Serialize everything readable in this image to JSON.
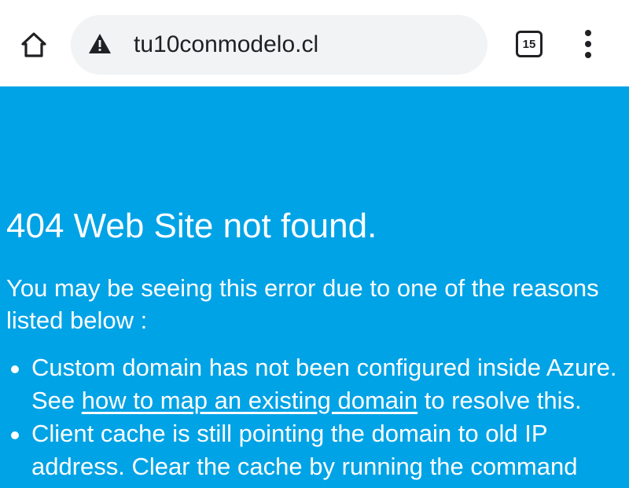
{
  "browser": {
    "url": "tu10conmodelo.cl",
    "tab_count": "15",
    "icons": {
      "home": "home-icon",
      "security": "warning-triangle-icon",
      "tabs": "tab-switcher-icon",
      "menu": "more-vert-icon"
    }
  },
  "page": {
    "background_color": "#00a3e6",
    "title": "404 Web Site not found.",
    "intro": "You may be seeing this error due to one of the reasons listed below :",
    "reasons": [
      {
        "prefix": "Custom domain has not been configured inside Azure. See ",
        "link_text": "how to map an existing domain",
        "suffix": " to resolve this."
      },
      {
        "text": "Client cache is still pointing the domain to old IP address. Clear the cache by running the command"
      }
    ]
  }
}
